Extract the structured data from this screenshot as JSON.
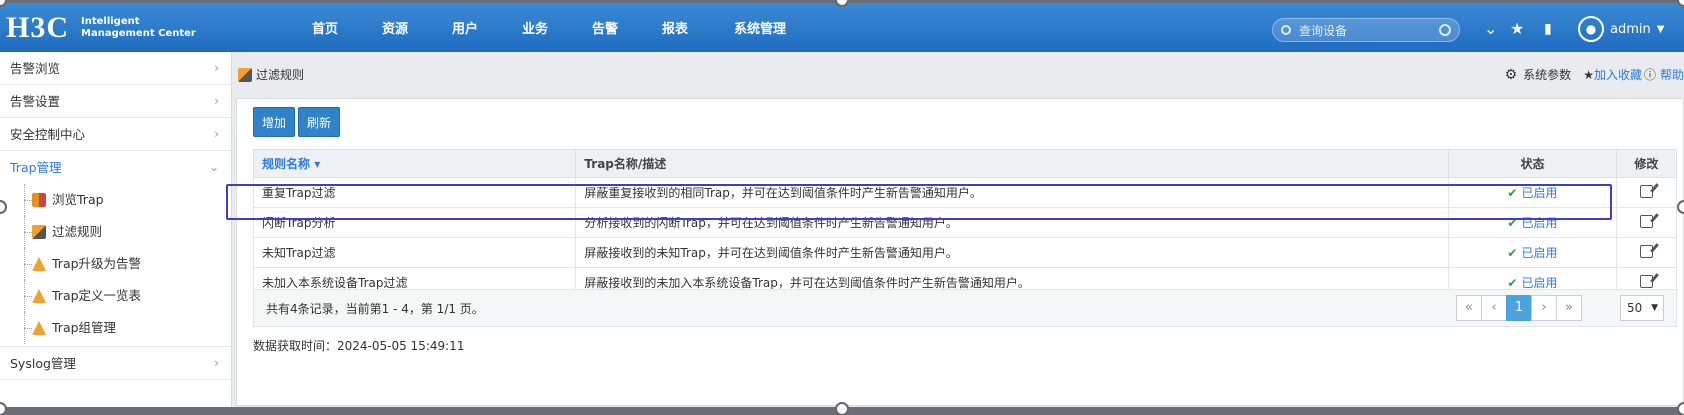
{
  "header": {
    "logo_mark": "H3C",
    "logo_line1": "Intelligent",
    "logo_line2": "Management Center",
    "nav": [
      "首页",
      "资源",
      "用户",
      "业务",
      "告警",
      "报表",
      "系统管理"
    ],
    "search_placeholder": "查询设备",
    "user_name": "admin"
  },
  "sidebar": {
    "items": [
      {
        "label": "告警浏览"
      },
      {
        "label": "告警设置"
      },
      {
        "label": "安全控制中心"
      },
      {
        "label": "Trap管理"
      }
    ],
    "trap_children": [
      {
        "label": "浏览Trap",
        "icon": "report-icon"
      },
      {
        "label": "过滤规则",
        "icon": "filter-icon"
      },
      {
        "label": "Trap升级为告警",
        "icon": "warning-icon"
      },
      {
        "label": "Trap定义一览表",
        "icon": "warning-icon"
      },
      {
        "label": "Trap组管理",
        "icon": "warning-icon"
      }
    ],
    "last_item": {
      "label": "Syslog管理"
    }
  },
  "content": {
    "breadcrumb": "过滤规则",
    "sys_params": "系统参数",
    "add_favorite": "加入收藏",
    "help": "帮助",
    "buttons": {
      "add": "增加",
      "refresh": "刷新"
    },
    "columns": {
      "name": "规则名称",
      "desc": "Trap名称/描述",
      "status": "状态",
      "edit": "修改"
    },
    "rows": [
      {
        "name": "重复Trap过滤",
        "desc": "屏蔽重复接收到的相同Trap，并可在达到阈值条件时产生新告警通知用户。",
        "status": "已启用"
      },
      {
        "name": "闪断Trap分析",
        "desc": "分析接收到的闪断Trap，并可在达到阈值条件时产生新告警通知用户。",
        "status": "已启用"
      },
      {
        "name": "未知Trap过滤",
        "desc": "屏蔽接收到的未知Trap，并可在达到阈值条件时产生新告警通知用户。",
        "status": "已启用"
      },
      {
        "name": "未加入本系统设备Trap过滤",
        "desc": "屏蔽接收到的未加入本系统设备Trap，并可在达到阈值条件时产生新告警通知用户。",
        "status": "已启用"
      }
    ],
    "summary": "共有4条记录，当前第1 - 4，第 1/1 页。",
    "pager": {
      "first": "«",
      "prev": "‹",
      "current": "1",
      "next": "›",
      "last": "»",
      "page_size": "50"
    },
    "fetch_time": "数据获取时间：2024-05-05 15:49:11"
  },
  "colors": {
    "header": "#1f6cbf",
    "accent": "#2c7be5",
    "highlight": "#3b3fcf",
    "ok": "#2c9e3a"
  }
}
